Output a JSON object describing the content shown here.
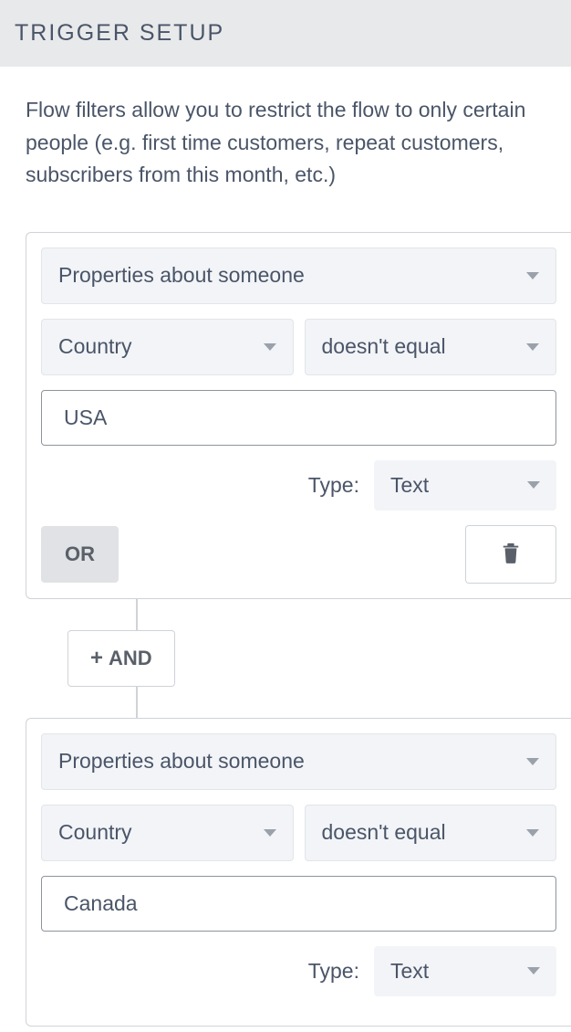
{
  "header": {
    "title": "TRIGGER SETUP"
  },
  "description": "Flow filters allow you to restrict the flow to only certain people (e.g. first time customers, repeat customers, subscribers from this month, etc.)",
  "labels": {
    "type": "Type:",
    "or": "OR",
    "and": "AND"
  },
  "filters": [
    {
      "category": "Properties about someone",
      "property": "Country",
      "operator": "doesn't equal",
      "value": "USA",
      "value_type": "Text"
    },
    {
      "category": "Properties about someone",
      "property": "Country",
      "operator": "doesn't equal",
      "value": "Canada",
      "value_type": "Text"
    }
  ]
}
